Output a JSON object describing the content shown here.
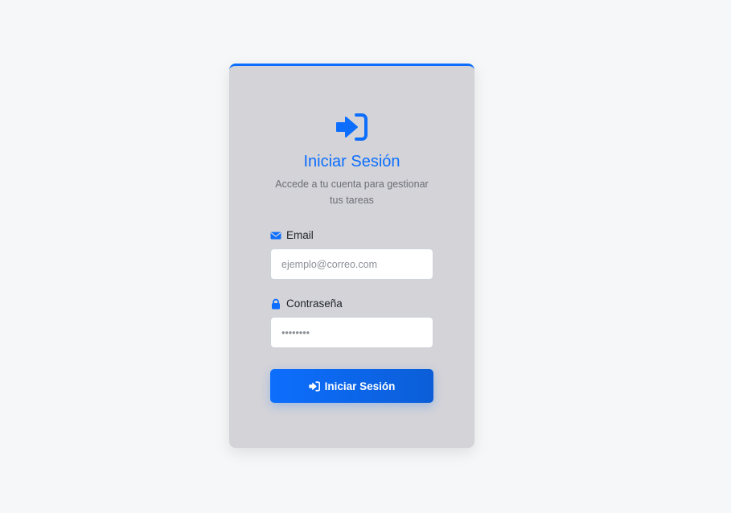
{
  "login": {
    "icon": "sign-in-icon",
    "title": "Iniciar Sesión",
    "subtitle": "Accede a tu cuenta para gestionar tus tareas",
    "email": {
      "icon": "envelope-icon",
      "label": "Email",
      "placeholder": "ejemplo@correo.com",
      "value": ""
    },
    "password": {
      "icon": "lock-icon",
      "label": "Contraseña",
      "placeholder": "••••••••",
      "value": ""
    },
    "submit": {
      "icon": "sign-in-icon",
      "label": "Iniciar Sesión"
    }
  },
  "colors": {
    "accent": "#0d6efd",
    "card_background": "#d3d3d8",
    "page_background": "#f6f7f9"
  }
}
